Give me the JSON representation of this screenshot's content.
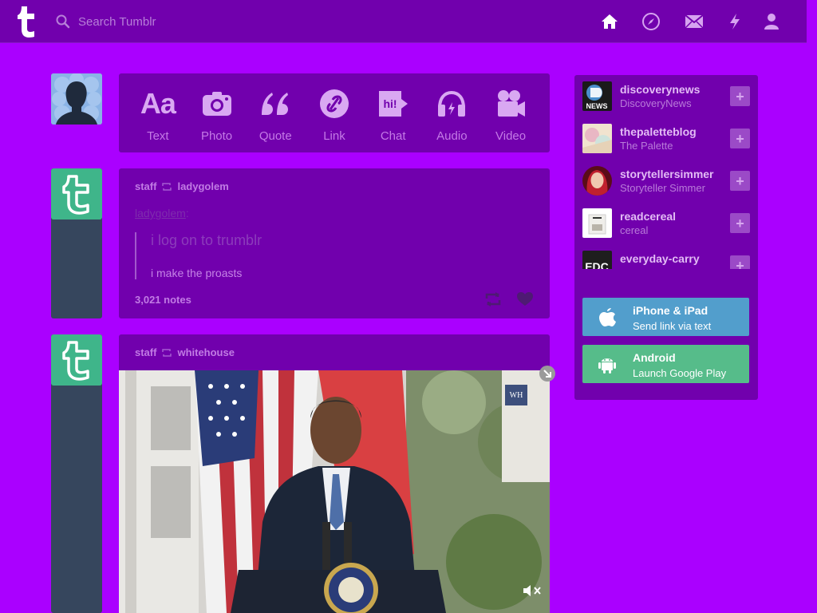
{
  "header": {
    "search_placeholder": "Search Tumblr",
    "nav": [
      "home-icon",
      "explore-icon",
      "inbox-icon",
      "activity-icon",
      "account-icon"
    ]
  },
  "post_types": [
    {
      "label": "Text",
      "icon": "text-icon"
    },
    {
      "label": "Photo",
      "icon": "camera-icon"
    },
    {
      "label": "Quote",
      "icon": "quote-icon"
    },
    {
      "label": "Link",
      "icon": "link-icon"
    },
    {
      "label": "Chat",
      "icon": "chat-icon"
    },
    {
      "label": "Audio",
      "icon": "headphones-icon"
    },
    {
      "label": "Video",
      "icon": "video-camera-icon"
    }
  ],
  "posts": [
    {
      "author": "staff",
      "reblogged_from": "ladygolem",
      "source_link": "ladygolem",
      "quote_line1": "i log on to trumblr",
      "quote_line2": "i make the proasts",
      "notes": "3,021 notes"
    },
    {
      "author": "staff",
      "reblogged_from": "whitehouse"
    }
  ],
  "recommended": [
    {
      "name": "discoverynews",
      "title": "DiscoveryNews"
    },
    {
      "name": "thepaletteblog",
      "title": "The Palette"
    },
    {
      "name": "storytellersimmer",
      "title": "Storyteller Simmer"
    },
    {
      "name": "readcereal",
      "title": "cereal"
    },
    {
      "name": "everyday-carry",
      "title": ""
    }
  ],
  "apps": [
    {
      "title": "iPhone & iPad",
      "subtitle": "Send link via text",
      "color": "#529ecc"
    },
    {
      "title": "Android",
      "subtitle": "Launch Google Play",
      "color": "#56bc8a"
    }
  ],
  "colors": {
    "background": "#aa00ff",
    "panel": "#7100ad",
    "avatar_green": "#3fb58a"
  }
}
